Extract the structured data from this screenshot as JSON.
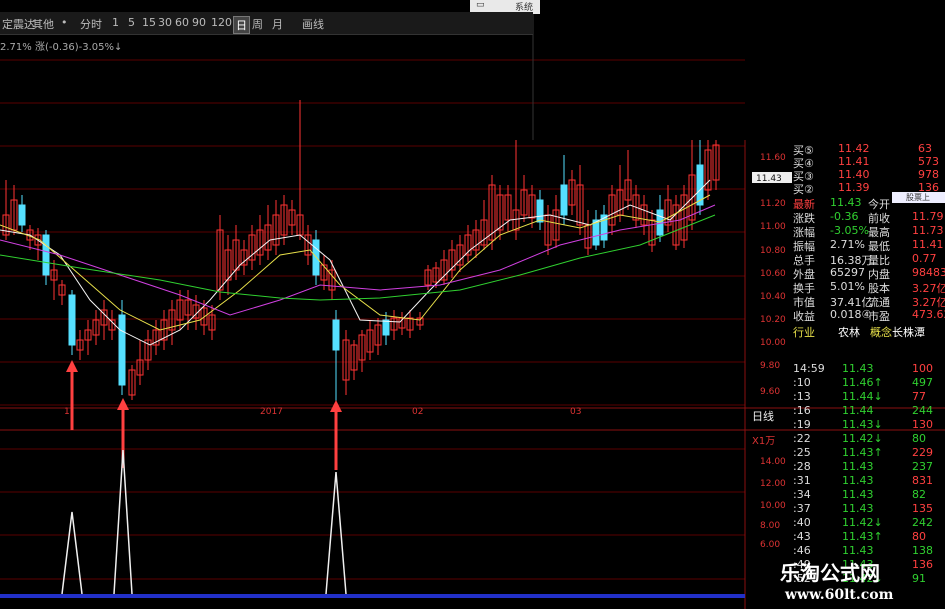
{
  "toolbar": {
    "left_label": "定震达",
    "other_label": "其他",
    "dot": "•",
    "periods": [
      "分时",
      "1",
      "5",
      "15",
      "30",
      "60",
      "90",
      "120",
      "日",
      "周",
      "月"
    ],
    "active_period": "日",
    "draw_label": "画线"
  },
  "info_line": "2.71%  涨(-0.36)-3.05%↓",
  "window_controls": {
    "sys_label": "系统"
  },
  "y_axis_price": [
    "11.60",
    "11.40",
    "11.20",
    "11.00",
    "10.80",
    "10.60",
    "10.40",
    "10.20",
    "10.00",
    "9.80",
    "9.60"
  ],
  "current_price_tag": "11.43",
  "x_axis_labels": [
    "1",
    "2017",
    "02",
    "03"
  ],
  "daily_tab": "日线",
  "indicator_unit": "X1万",
  "y_axis_indicator": [
    "14.00",
    "12.00",
    "10.00",
    "8.00",
    "6.00"
  ],
  "share_button": "股票上",
  "order_book": [
    {
      "label": "买⑤",
      "price": "11.42",
      "vol": "63"
    },
    {
      "label": "买④",
      "price": "11.41",
      "vol": "573"
    },
    {
      "label": "买③",
      "price": "11.40",
      "vol": "978"
    },
    {
      "label": "买②",
      "price": "11.39",
      "vol": "136"
    }
  ],
  "stats": [
    {
      "l1": "最新",
      "v1": "11.43",
      "l2": "今开",
      "v2": ""
    },
    {
      "l1": "涨跌",
      "v1": "-0.36",
      "l2": "前收",
      "v2": "11.79"
    },
    {
      "l1": "涨幅",
      "v1": "-3.05%",
      "l2": "最高",
      "v2": "11.73"
    },
    {
      "l1": "振幅",
      "v1": "2.71%",
      "l2": "最低",
      "v2": "11.41"
    },
    {
      "l1": "总手",
      "v1": "16.38万",
      "l2": "量比",
      "v2": "0.77"
    },
    {
      "l1": "外盘",
      "v1": "65297",
      "l2": "内盘",
      "v2": "98483"
    },
    {
      "l1": "换手",
      "v1": "5.01%",
      "l2": "股本",
      "v2": "3.27亿"
    },
    {
      "l1": "市值",
      "v1": "37.41亿",
      "l2": "流通",
      "v2": "3.27亿"
    },
    {
      "l1": "收益",
      "v1": "0.018④",
      "l2": "市盈",
      "v2": "473.62"
    }
  ],
  "industry": {
    "label": "行业",
    "value": "农林",
    "concept_label": "概念",
    "concept_value": "长株潭"
  },
  "ticks": [
    {
      "t": "14:59",
      "p": "11.43",
      "v": "100"
    },
    {
      "t": ":10",
      "p": "11.46↑",
      "v": "497"
    },
    {
      "t": ":13",
      "p": "11.44↓",
      "v": "77"
    },
    {
      "t": ":16",
      "p": "11.44",
      "v": "244"
    },
    {
      "t": ":19",
      "p": "11.43↓",
      "v": "130"
    },
    {
      "t": ":22",
      "p": "11.42↓",
      "v": "80"
    },
    {
      "t": ":25",
      "p": "11.43↑",
      "v": "229"
    },
    {
      "t": ":28",
      "p": "11.43",
      "v": "237"
    },
    {
      "t": ":31",
      "p": "11.43",
      "v": "831"
    },
    {
      "t": ":34",
      "p": "11.43",
      "v": "82"
    },
    {
      "t": ":37",
      "p": "11.43",
      "v": "135"
    },
    {
      "t": ":40",
      "p": "11.42↓",
      "v": "242"
    },
    {
      "t": ":43",
      "p": "11.43↑",
      "v": "80"
    },
    {
      "t": ":46",
      "p": "11.43",
      "v": "138"
    },
    {
      "t": ":49",
      "p": "11.43",
      "v": "136"
    },
    {
      "t": ":52",
      "p": "11.42↓",
      "v": "91"
    }
  ],
  "watermark": {
    "title": "乐淘公式网",
    "url": "www.60lt.com"
  },
  "colors": {
    "up": "#ff3333",
    "down": "#55e0ff",
    "ma5": "#f5f5f5",
    "ma10": "#e8e04a",
    "ma20": "#d040e0",
    "ma60": "#30d030",
    "grid": "#5a0000",
    "arrow": "#ff4040"
  }
}
